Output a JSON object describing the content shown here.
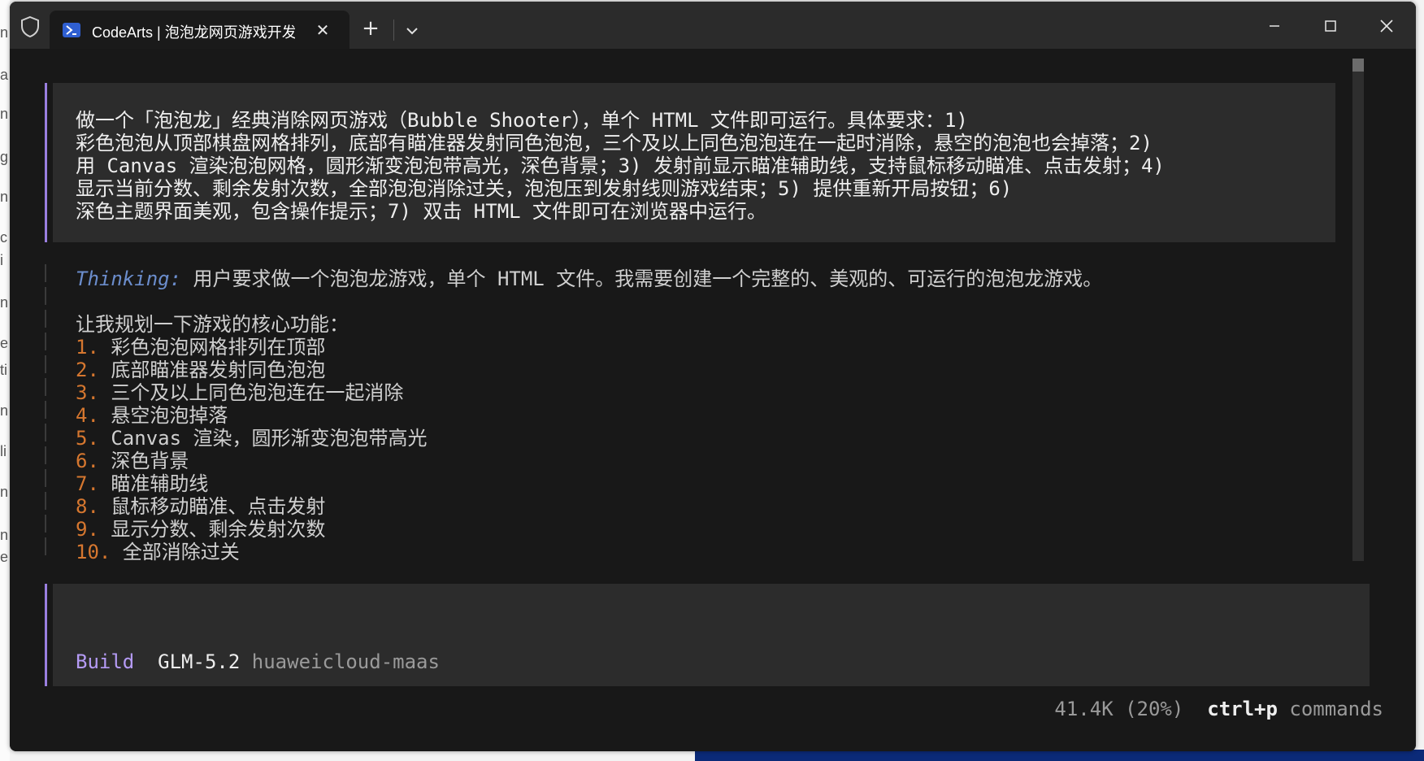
{
  "window": {
    "tab_title": "CodeArts | 泡泡龙网页游戏开发",
    "tab_close": "✕",
    "new_tab": "+",
    "minimize": "—",
    "maximize": "□",
    "close": "✕"
  },
  "prompt": {
    "lines": [
      "做一个「泡泡龙」经典消除网页游戏（Bubble Shooter），单个 HTML 文件即可运行。具体要求：1)",
      "彩色泡泡从顶部棋盘网格排列，底部有瞄准器发射同色泡泡，三个及以上同色泡泡连在一起时消除，悬空的泡泡也会掉落；2)",
      "用 Canvas 渲染泡泡网格，圆形渐变泡泡带高光，深色背景；3) 发射前显示瞄准辅助线，支持鼠标移动瞄准、点击发射；4)",
      "显示当前分数、剩余发射次数，全部泡泡消除过关，泡泡压到发射线则游戏结束；5) 提供重新开局按钮；6)",
      "深色主题界面美观，包含操作提示；7) 双击 HTML 文件即可在浏览器中运行。"
    ]
  },
  "thinking": {
    "label": "Thinking:",
    "summary": " 用户要求做一个泡泡龙游戏，单个 HTML 文件。我需要创建一个完整的、美观的、可运行的泡泡龙游戏。",
    "plan_intro": "让我规划一下游戏的核心功能：",
    "items": [
      {
        "num": "1.",
        "text": " 彩色泡泡网格排列在顶部"
      },
      {
        "num": "2.",
        "text": " 底部瞄准器发射同色泡泡"
      },
      {
        "num": "3.",
        "text": " 三个及以上同色泡泡连在一起消除"
      },
      {
        "num": "4.",
        "text": " 悬空泡泡掉落"
      },
      {
        "num": "5.",
        "text": " Canvas 渲染，圆形渐变泡泡带高光"
      },
      {
        "num": "6.",
        "text": " 深色背景"
      },
      {
        "num": "7.",
        "text": " 瞄准辅助线"
      },
      {
        "num": "8.",
        "text": " 鼠标移动瞄准、点击发射"
      },
      {
        "num": "9.",
        "text": " 显示分数、剩余发射次数"
      },
      {
        "num": "10.",
        "text": " 全部消除过关"
      }
    ]
  },
  "status": {
    "mode": "Build",
    "model": "GLM-5.2",
    "provider": "huaweicloud-maas"
  },
  "footer": {
    "tokens": "41.4K (20%)",
    "shortcut": "ctrl+p",
    "shortcut_label": " commands"
  },
  "background": {
    "left_edge_chars": [
      "n",
      "a",
      "n",
      "g",
      "n",
      "c",
      "i",
      "n",
      "e",
      "ti",
      "n",
      "li",
      "n",
      "n",
      "e"
    ]
  }
}
